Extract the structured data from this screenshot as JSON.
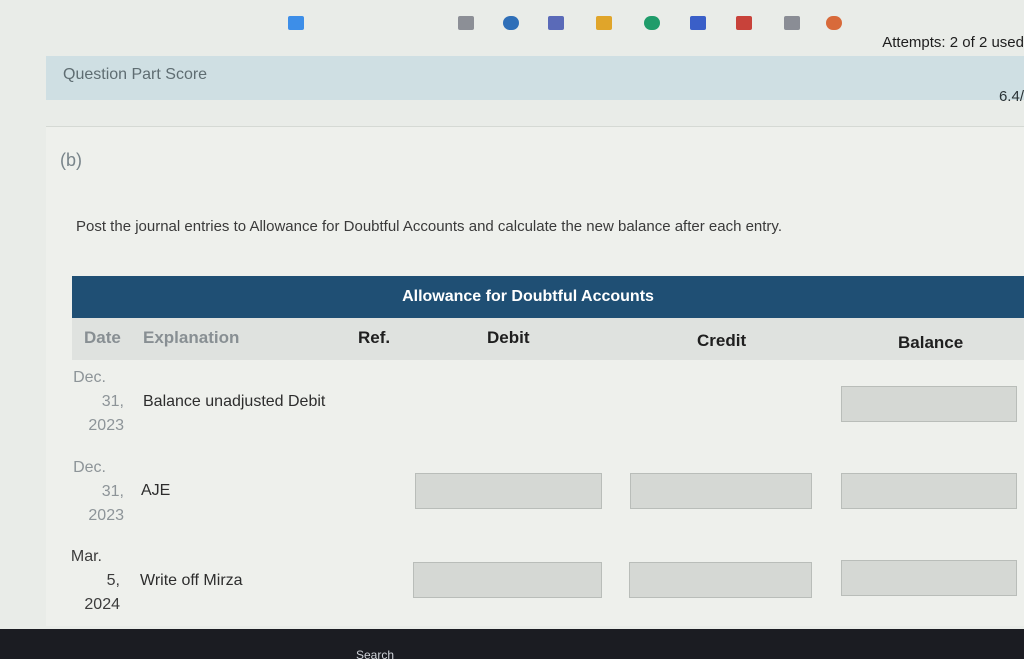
{
  "header": {
    "attempts": "Attempts: 2 of 2 used",
    "score_label": "Question Part Score",
    "score_value": "6.4/"
  },
  "part": {
    "label": "(b)",
    "instruction": "Post the journal entries to Allowance for Doubtful Accounts and calculate the new balance after each entry."
  },
  "ledger": {
    "title": "Allowance for Doubtful Accounts",
    "columns": {
      "date": "Date",
      "explanation": "Explanation",
      "ref": "Ref.",
      "debit": "Debit",
      "credit": "Credit",
      "balance": "Balance"
    },
    "rows": [
      {
        "month": "Dec.",
        "day": "31,",
        "year": "2023",
        "explanation": "Balance unadjusted Debit",
        "debit": "",
        "credit": "",
        "balance": ""
      },
      {
        "month": "Dec.",
        "day": "31,",
        "year": "2023",
        "explanation": "AJE",
        "debit": "",
        "credit": "",
        "balance": ""
      },
      {
        "month": "Mar.",
        "day": "5,",
        "year": "2024",
        "explanation": "Write off Mirza",
        "debit": "",
        "credit": "",
        "balance": ""
      }
    ]
  },
  "taskbar": {
    "search_label": "Search"
  },
  "colors": {
    "table_header": "#1f4f74",
    "score_bar": "#cfdfe3",
    "taskbar": "#1b1c22"
  }
}
